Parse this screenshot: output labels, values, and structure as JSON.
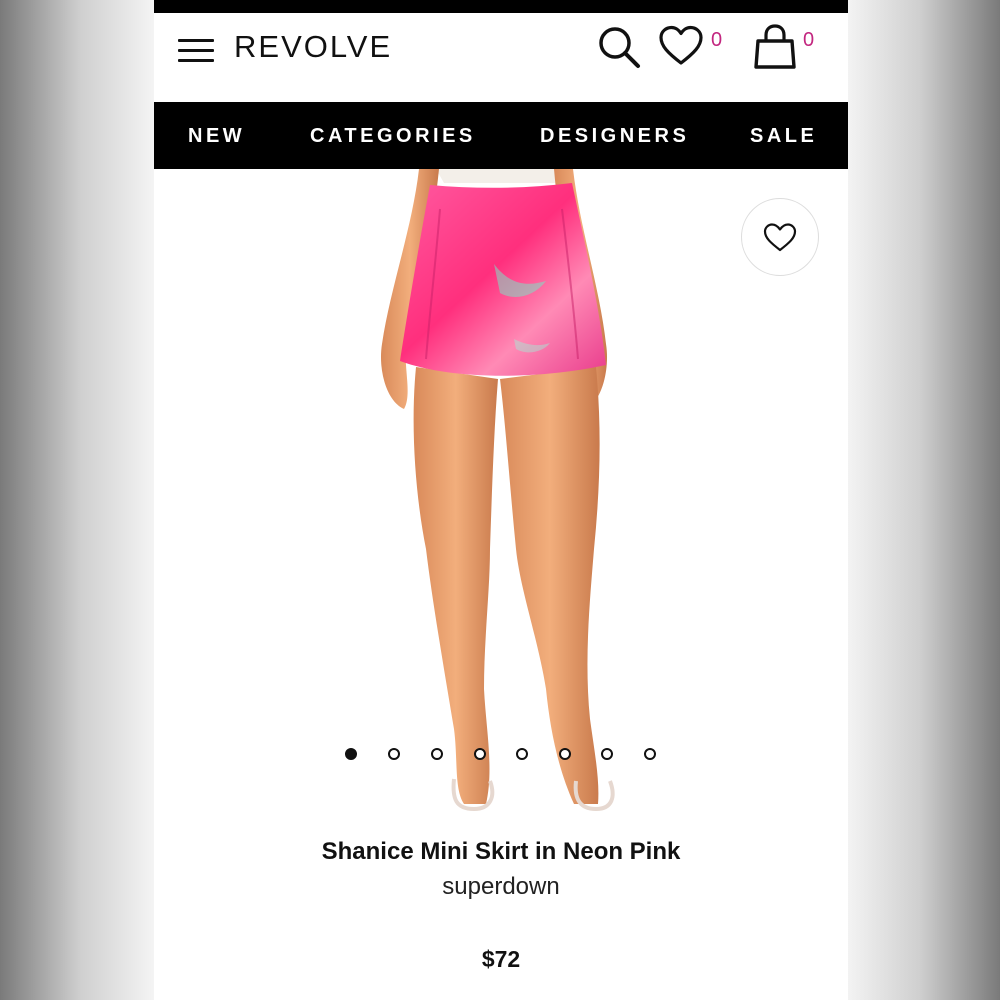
{
  "header": {
    "logo": "REVOLVE",
    "wishlist_count": "0",
    "bag_count": "0",
    "icons": [
      "menu-icon",
      "search-icon",
      "heart-icon",
      "shopping-bag-icon"
    ]
  },
  "nav": {
    "items": [
      "NEW",
      "CATEGORIES",
      "DESIGNERS",
      "SALE"
    ]
  },
  "gallery": {
    "total_images": 8,
    "active_index": 0,
    "fav_icon": "heart-icon"
  },
  "product": {
    "name": "Shanice Mini Skirt in Neon Pink",
    "brand": "superdown",
    "price": "$72"
  },
  "colors": {
    "accent_count": "#c2267f",
    "nav_bg": "#000000",
    "skirt": "#ff3f8a"
  }
}
